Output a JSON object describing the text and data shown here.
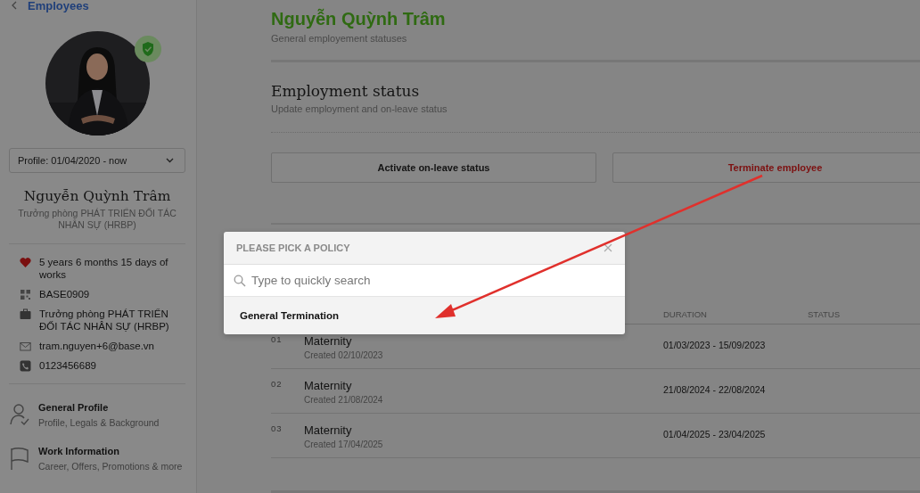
{
  "back_link": {
    "label": "Employees"
  },
  "profile": {
    "period_select": "Profile: 01/04/2020 - now",
    "name": "Nguyễn Quỳnh Trâm",
    "title": "Trưởng phòng PHÁT TRIỂN ĐỐI TÁC NHÂN SỰ (HRBP)"
  },
  "info": [
    {
      "kind": "tenure",
      "text": "5 years 6 months 15 days of works"
    },
    {
      "kind": "code",
      "text": "BASE0909"
    },
    {
      "kind": "position",
      "text": "Trưởng phòng PHÁT TRIỂN ĐỐI TÁC NHÂN SỰ (HRBP)"
    },
    {
      "kind": "email",
      "text": "tram.nguyen+6@base.vn"
    },
    {
      "kind": "phone",
      "text": "0123456689"
    }
  ],
  "nav": [
    {
      "kind": "profile",
      "title": "General Profile",
      "subtitle": "Profile, Legals & Background"
    },
    {
      "kind": "work",
      "title": "Work Information",
      "subtitle": "Career, Offers, Promotions & more"
    }
  ],
  "header": {
    "title": "Nguyễn Quỳnh Trâm",
    "subtitle": "General employement statuses"
  },
  "section": {
    "title": "Employment status",
    "subtitle": "Update employment and on-leave status"
  },
  "actions": [
    {
      "label": "Activate on-leave status",
      "kind": "neutral"
    },
    {
      "label": "Terminate employee",
      "kind": "danger"
    }
  ],
  "table": {
    "columns": [
      "DURATION",
      "STATUS"
    ],
    "rows": [
      {
        "index": "01",
        "type": "Maternity",
        "created": "Created 02/10/2023",
        "duration": "01/03/2023 - 15/09/2023"
      },
      {
        "index": "02",
        "type": "Maternity",
        "created": "Created 21/08/2024",
        "duration": "21/08/2024 - 22/08/2024"
      },
      {
        "index": "03",
        "type": "Maternity",
        "created": "Created 17/04/2025",
        "duration": "01/04/2025 - 23/04/2025"
      }
    ]
  },
  "modal": {
    "title": "PLEASE PICK A POLICY",
    "search": {
      "placeholder": "Type to quickly search"
    },
    "options": [
      {
        "label": "General Termination"
      }
    ]
  }
}
